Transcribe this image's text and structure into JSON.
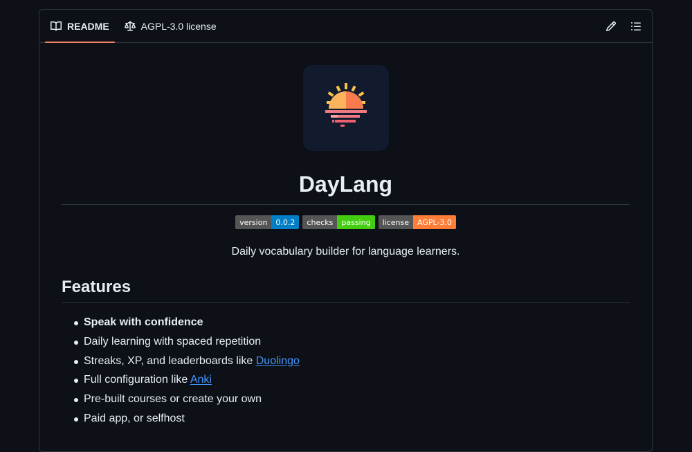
{
  "tabs": [
    {
      "label": "README",
      "icon": "book-icon",
      "active": true
    },
    {
      "label": "AGPL-3.0 license",
      "icon": "law-scale-icon",
      "active": false
    }
  ],
  "actions": [
    {
      "icon": "pencil-icon"
    },
    {
      "icon": "list-unordered-icon"
    }
  ],
  "readme": {
    "logo_icon": "sunset-logo-icon",
    "title": "DayLang",
    "badges": [
      {
        "label": "version",
        "value": "0.0.2",
        "color": "#007ec6"
      },
      {
        "label": "checks",
        "value": "passing",
        "color": "#44cc11"
      },
      {
        "label": "license",
        "value": "AGPL-3.0",
        "color": "#fe7d37"
      }
    ],
    "description": "Daily vocabulary builder for language learners.",
    "features_heading": "Features",
    "features": [
      {
        "text": "Speak with confidence",
        "bold": true
      },
      {
        "text": "Daily learning with spaced repetition"
      },
      {
        "text": "Streaks, XP, and leaderboards like ",
        "link": "Duolingo"
      },
      {
        "text": "Full configuration like ",
        "link": "Anki"
      },
      {
        "text": "Pre-built courses or create your own"
      },
      {
        "text": "Paid app, or selfhost"
      }
    ]
  },
  "colors": {
    "link": "#4493f8",
    "tab_underline": "#f78166"
  }
}
